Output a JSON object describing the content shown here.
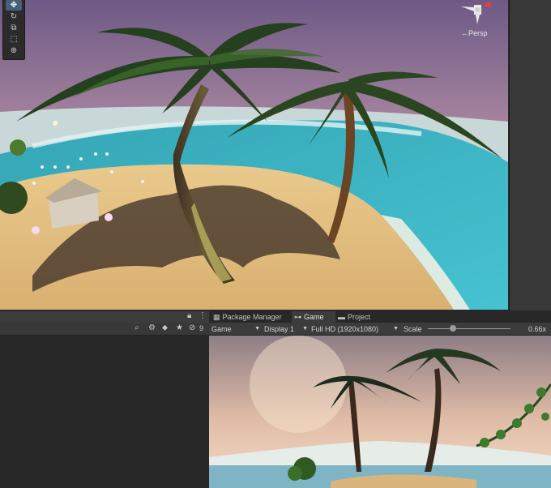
{
  "scene": {
    "camera_label": "←Persp",
    "tools": [
      "move-tool-icon",
      "rotate-tool-icon",
      "scale-tool-icon",
      "rect-tool-icon",
      "transform-tool-icon"
    ]
  },
  "hierarchy_toolbar": {
    "hidden_count": "9"
  },
  "tabs": [
    {
      "label": "Package Manager",
      "icon": "package-icon"
    },
    {
      "label": "Game",
      "icon": "gamepad-icon",
      "active": true
    },
    {
      "label": "Project",
      "icon": "folder-icon"
    }
  ],
  "game_toolbar": {
    "view_mode": "Game",
    "display": "Display 1",
    "resolution": "Full HD (1920x1080)",
    "scale_label": "Scale",
    "scale_value": "0.66x",
    "scale_fraction": 0.3
  },
  "colors": {
    "selected_tool": "#46607c",
    "panel_bg": "#282828",
    "toolbar_bg": "#3c3c3c"
  }
}
